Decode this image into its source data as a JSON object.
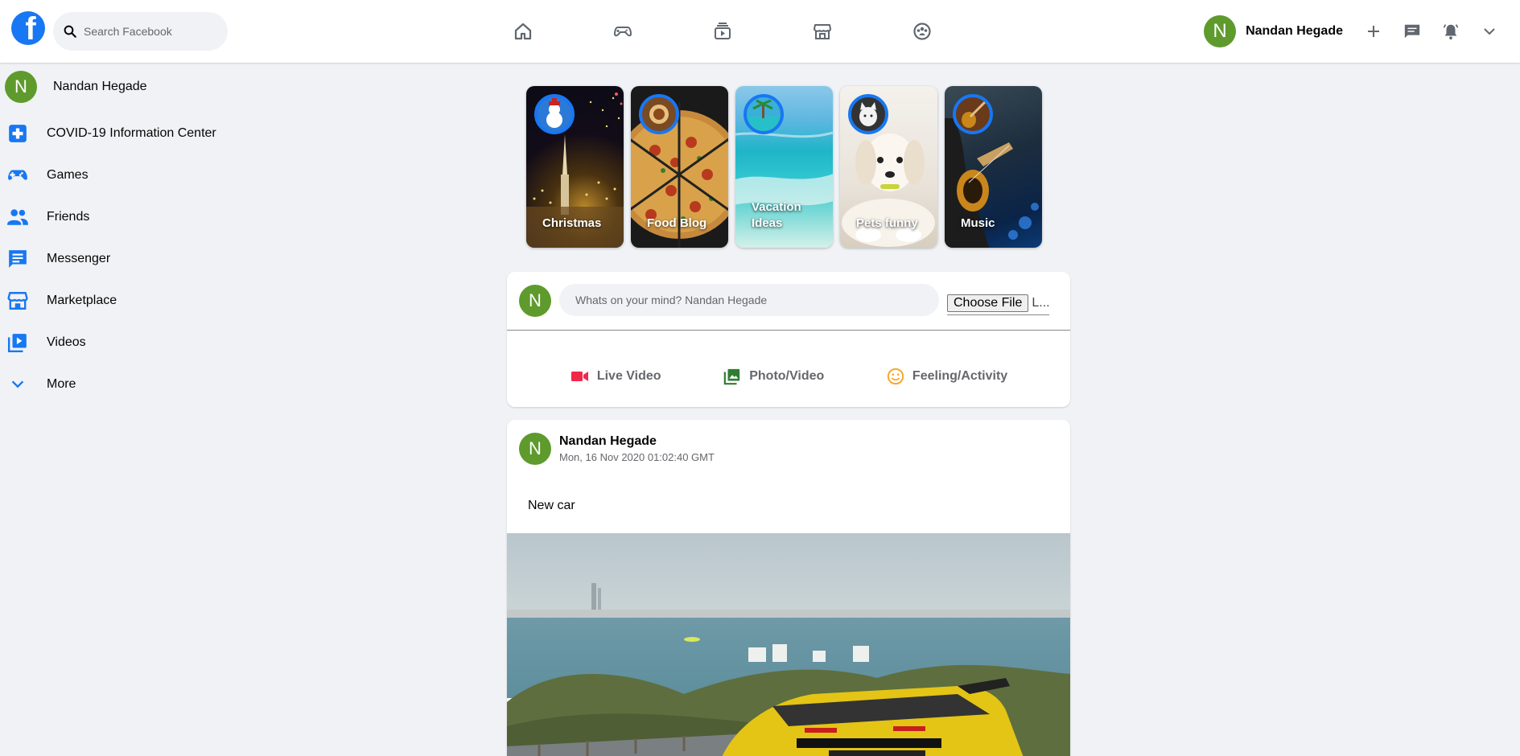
{
  "header": {
    "search_placeholder": "Search Facebook",
    "nav": [
      {
        "icon": "home-icon"
      },
      {
        "icon": "gaming-icon"
      },
      {
        "icon": "watch-icon"
      },
      {
        "icon": "marketplace-icon"
      },
      {
        "icon": "groups-icon"
      }
    ],
    "user_initial": "N",
    "user_name": "Nandan Hegade"
  },
  "sidebar": {
    "user_initial": "N",
    "user_name": "Nandan Hegade",
    "items": [
      {
        "label": "COVID-19 Information Center",
        "icon": "plus-box-icon"
      },
      {
        "label": "Games",
        "icon": "gamepad-icon"
      },
      {
        "label": "Friends",
        "icon": "friends-icon"
      },
      {
        "label": "Messenger",
        "icon": "message-icon"
      },
      {
        "label": "Marketplace",
        "icon": "store-icon"
      },
      {
        "label": "Videos",
        "icon": "video-library-icon"
      },
      {
        "label": "More",
        "icon": "chevron-down-icon"
      }
    ]
  },
  "stories": [
    {
      "label": "Christmas"
    },
    {
      "label": "Food Blog"
    },
    {
      "label": "Vacation Ideas"
    },
    {
      "label": "Pets funny"
    },
    {
      "label": "Music"
    }
  ],
  "composer": {
    "user_initial": "N",
    "placeholder": "Whats on your mind? Nandan Hegade",
    "file_button": "Choose File",
    "file_status": "L...",
    "actions": [
      {
        "label": "Live Video",
        "icon": "video-camera-icon",
        "color": "#f02849"
      },
      {
        "label": "Photo/Video",
        "icon": "photo-icon",
        "color": "#45bd62"
      },
      {
        "label": "Feeling/Activity",
        "icon": "smiley-icon",
        "color": "#f7b928"
      }
    ]
  },
  "post": {
    "user_initial": "N",
    "author": "Nandan Hegade",
    "timestamp": "Mon, 16 Nov 2020 01:02:40 GMT",
    "text": "New car"
  },
  "colors": {
    "brand": "#1877f2",
    "avatar": "#5f9a2d",
    "background": "#f0f2f5"
  }
}
